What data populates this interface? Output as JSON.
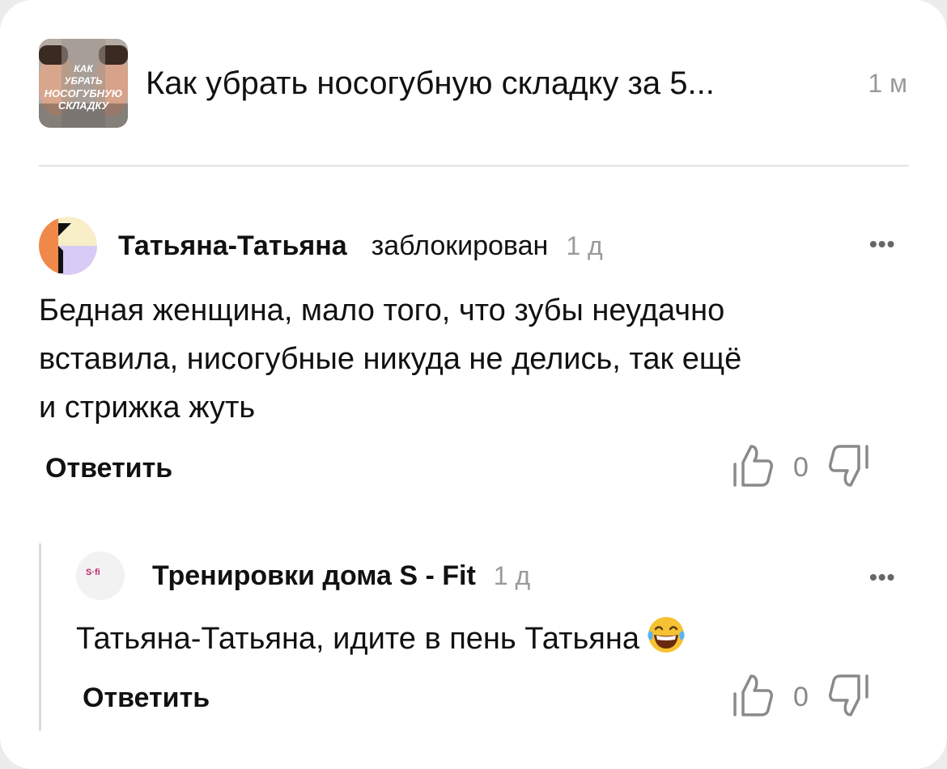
{
  "article": {
    "thumbnail_lines": [
      "КАК",
      "УБРАТЬ",
      "НОСОГУБНУЮ",
      "СКЛАДКУ"
    ],
    "title": "Как убрать носогубную складку за 5...",
    "time": "1 м"
  },
  "comments": [
    {
      "author": "Татьяна-Татьяна",
      "status": "заблокирован",
      "time": "1 д",
      "more_label": "•••",
      "lines": [
        "Бедная женщина, мало того, что зубы неудачно",
        "вставила, нисогубные никуда не делись, так ещё",
        "и стрижка жуть"
      ],
      "reply_label": "Ответить",
      "votes": "0",
      "icons": {
        "like": "thumbs-up-icon",
        "dislike": "thumbs-down-icon",
        "more": "more-dots-icon"
      }
    },
    {
      "author": "Тренировки дома S - Fit",
      "avatar_text": "S·fi",
      "time": "1 д",
      "more_label": "•••",
      "text": "Татьяна-Татьяна, идите в пень Татьяна",
      "emoji": "laughing-tears-emoji",
      "reply_label": "Ответить",
      "votes": "0",
      "icons": {
        "like": "thumbs-up-icon",
        "dislike": "thumbs-down-icon",
        "more": "more-dots-icon"
      }
    }
  ],
  "colors": {
    "avatar_orange": "#f0884a",
    "avatar_cream": "#f8eec8",
    "avatar_lilac": "#d8ccf6",
    "meta_gray": "#9a9a9a"
  }
}
